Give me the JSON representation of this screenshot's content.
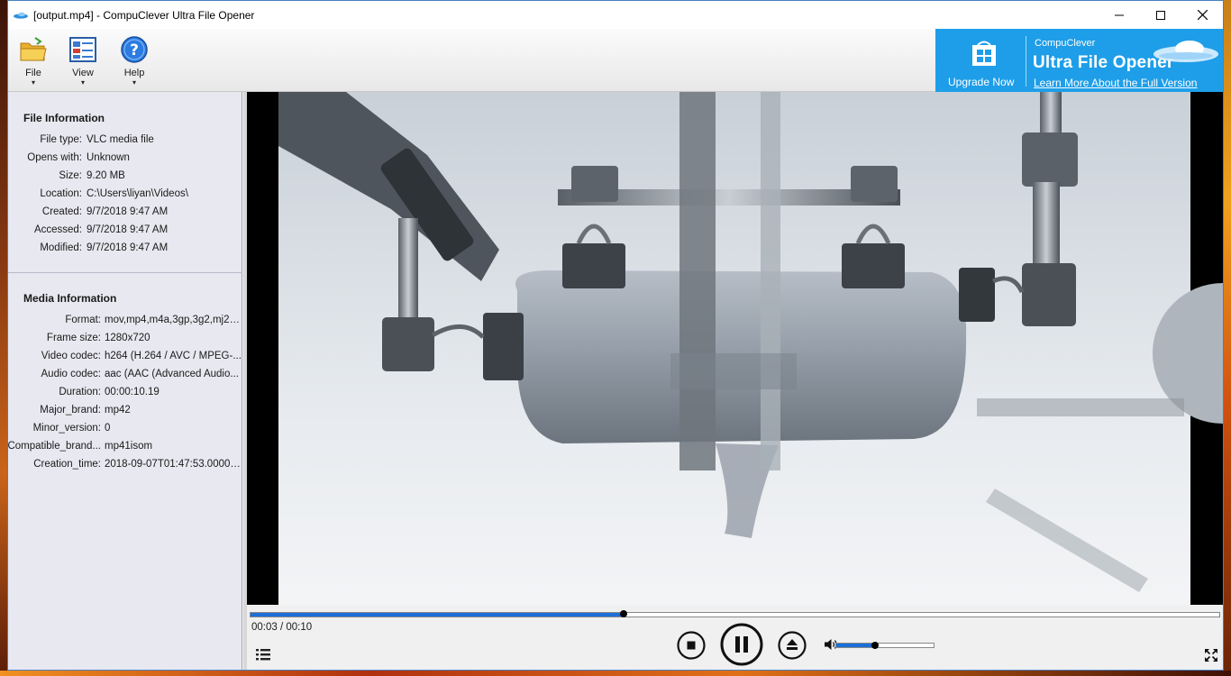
{
  "window": {
    "title": "[output.mp4] - CompuClever Ultra File Opener"
  },
  "toolbar": {
    "file_label": "File",
    "view_label": "View",
    "help_label": "Help",
    "caret": "▾"
  },
  "promo": {
    "upgrade_label": "Upgrade Now",
    "brand": "CompuClever",
    "product": "Ultra File Opener",
    "link": "Learn More About the Full Version",
    "accent": "#1e9ee8"
  },
  "file_info": {
    "title": "File Information",
    "rows": [
      {
        "key": "File type:",
        "value": "VLC media file"
      },
      {
        "key": "Opens with:",
        "value": "Unknown"
      },
      {
        "key": "Size:",
        "value": "9.20 MB"
      },
      {
        "key": "Location:",
        "value": "C:\\Users\\liyan\\Videos\\"
      },
      {
        "key": "Created:",
        "value": "9/7/2018 9:47 AM"
      },
      {
        "key": "Accessed:",
        "value": "9/7/2018 9:47 AM"
      },
      {
        "key": "Modified:",
        "value": "9/7/2018 9:47 AM"
      }
    ]
  },
  "media_info": {
    "title": "Media Information",
    "rows": [
      {
        "key": "Format:",
        "value": "mov,mp4,m4a,3gp,3g2,mj2 (..."
      },
      {
        "key": "Frame size:",
        "value": "1280x720"
      },
      {
        "key": "Video codec:",
        "value": "h264 (H.264 / AVC / MPEG-..."
      },
      {
        "key": "Audio codec:",
        "value": "aac (AAC (Advanced Audio..."
      },
      {
        "key": "Duration:",
        "value": "00:00:10.19"
      },
      {
        "key": "Major_brand:",
        "value": "mp42"
      },
      {
        "key": "Minor_version:",
        "value": "0"
      },
      {
        "key": "Compatible_brand...",
        "value": "mp41isom"
      },
      {
        "key": "Creation_time:",
        "value": "2018-09-07T01:47:53.00000..."
      }
    ]
  },
  "player": {
    "time_display": "00:03 / 00:10",
    "progress_fraction": 0.385,
    "volume_fraction": 0.4
  }
}
